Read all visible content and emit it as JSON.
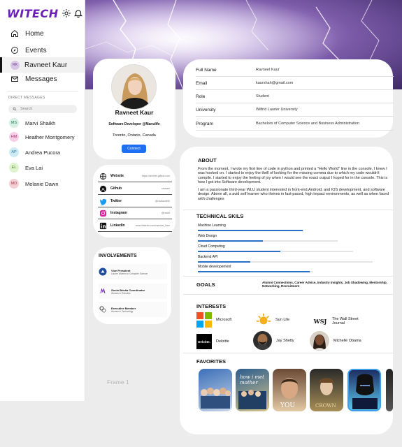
{
  "app": {
    "logo": "WITECH",
    "brand_color": "#6a1fb5",
    "accent": "#1f6ff2"
  },
  "header_icons": [
    "gear-icon",
    "bell-icon"
  ],
  "nav": [
    {
      "label": "Home",
      "icon": "home-icon"
    },
    {
      "label": "Events",
      "icon": "compass-icon"
    },
    {
      "label": "Ravneet Kaur",
      "icon": "avatar",
      "initials": "RK",
      "active": true
    },
    {
      "label": "Messages",
      "icon": "mail-icon"
    }
  ],
  "direct_messages": {
    "label": "DIRECT MESSAGES",
    "search_placeholder": "Search",
    "contacts": [
      {
        "initials": "MS",
        "name": "Marvi Shaikh",
        "color": "#d6f0e3",
        "text": "#2e7d57"
      },
      {
        "initials": "HM",
        "name": "Heather Montgomery",
        "color": "#f6cfe6",
        "text": "#a3307a"
      },
      {
        "initials": "AP",
        "name": "Andrea Pucora",
        "color": "#cdeaf4",
        "text": "#2b7f9c"
      },
      {
        "initials": "EL",
        "name": "Eva Lai",
        "color": "#dff3cf",
        "text": "#4e8a29"
      },
      {
        "initials": "MD",
        "name": "Melanie Dawn",
        "color": "#f4cfd4",
        "text": "#a83a4c"
      }
    ]
  },
  "profile": {
    "name": "Ravneet Kaur",
    "role": "Software Developer @Manulife",
    "location": "Toronto, Ontario, Canada",
    "connect_label": "Connect"
  },
  "links": [
    {
      "name": "Website",
      "value": "https://ravneet.github.com",
      "icon": "globe-icon"
    },
    {
      "name": "Github",
      "value": "ravkaur",
      "icon": "github-icon"
    },
    {
      "name": "Twitter",
      "value": "@ravkaur890",
      "icon": "twitter-icon"
    },
    {
      "name": "Instagram",
      "value": "@ravk8",
      "icon": "instagram-icon"
    },
    {
      "name": "LinkedIn",
      "value": "www.linkedin.com/ravneet_kaur",
      "icon": "linkedin-icon"
    }
  ],
  "involvements": {
    "title": "INVOLVEMENTS",
    "items": [
      {
        "title": "Vice President",
        "sub": "Laurier Women in Computer Science"
      },
      {
        "title": "Social Media Coordinator",
        "sub": "Women in Robotics"
      },
      {
        "title": "Executive Member",
        "sub": "Women in Technology"
      }
    ]
  },
  "info": [
    {
      "key": "Full Name",
      "value": "Ravneet Kaur"
    },
    {
      "key": "Email",
      "value": "kaurshah@gmail.com"
    },
    {
      "key": "Role",
      "value": "Student"
    },
    {
      "key": "University",
      "value": "Wilfrid Laurier University"
    },
    {
      "key": "Program",
      "value": "Bachelors of Computer Science and Business Administration"
    }
  ],
  "about": {
    "title": "ABOUT",
    "paragraphs": [
      "From the moment, I wrote my first line of code in python and printed a \"Hello World\" line in the console, I knew I was hooked on. I started to enjoy the thrill of looking for the missing comma due to which my code wouldn't compile. I started to enjoy the feeling of joy when I would see the exact output I hoped for in the console. This is how I got into Software development.",
      "I am a passionate third-year WLU student interested in front-end,Android, and IOS development, and software design. Above all, a avid self learner who thrives in fast-paced, high impact environments, as well as when faced with challenges"
    ]
  },
  "skills": {
    "title": "TECHNICAL SKILS",
    "items": [
      {
        "name": "Machine Learning",
        "level": 0.6
      },
      {
        "name": "Web Design",
        "level": 0.37
      },
      {
        "name": "Cloud Computing",
        "level": 0.47
      },
      {
        "name": "Backend API",
        "level": 0.3
      },
      {
        "name": "Mobile developement",
        "level": 0.64
      }
    ]
  },
  "goals": {
    "title": "GOALS",
    "text": "Alumni Connections, Career Advice, Industry Insights, Job Shadowing, Mentorship, Networking, Recruitment"
  },
  "interests": {
    "title": "INTERESTS",
    "items": [
      {
        "name": "Microsoft",
        "logo": "microsoft-logo"
      },
      {
        "name": "Sun Life",
        "logo": "sunlife-logo"
      },
      {
        "name": "The Wall Street Journal",
        "logo": "wsj-logo",
        "mark": "WSJ"
      },
      {
        "name": "Deloitte",
        "logo": "deloitte-logo",
        "mark": "Deloitte."
      },
      {
        "name": "Jay Shetty",
        "logo": "jay-shetty-photo"
      },
      {
        "name": "Michelle Obama",
        "logo": "michelle-obama-photo"
      }
    ]
  },
  "favorites": {
    "title": "FAVORITES",
    "items": [
      {
        "name": "Friends",
        "colors": [
          "#3b6fb8",
          "#c9d7ea"
        ]
      },
      {
        "name": "How I Met Your Mother",
        "colors": [
          "#2b5d8e",
          "#d8c58a"
        ]
      },
      {
        "name": "You",
        "caption": "YOU",
        "colors": [
          "#6b4a35",
          "#e3c9a5"
        ]
      },
      {
        "name": "The Crown",
        "caption": "CROWN",
        "colors": [
          "#2a2a2a",
          "#a88e55"
        ]
      },
      {
        "name": "Black Panther",
        "colors": [
          "#1d2f64",
          "#5dc6ee"
        ]
      },
      {
        "name": "",
        "colors": [
          "#222",
          "#555"
        ]
      }
    ]
  },
  "frame_label": "Frame 1"
}
